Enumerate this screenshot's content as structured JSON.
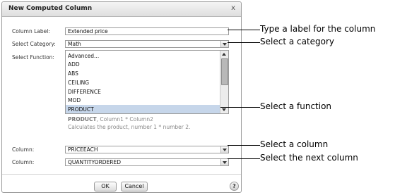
{
  "dialog": {
    "title": "New Computed Column",
    "close_glyph": "x",
    "column_label": {
      "label": "Column Label:",
      "value": "Extended price"
    },
    "category": {
      "label": "Select Category:",
      "value": "Math"
    },
    "function": {
      "label": "Select Function:",
      "items": [
        "Advanced...",
        "ADD",
        "ABS",
        "CEILING",
        "DIFFERENCE",
        "MOD",
        "PRODUCT"
      ],
      "selected": "PRODUCT"
    },
    "description": {
      "name": "PRODUCT",
      "signature": ", Column1 * Column2",
      "text": "Calculates the product, number 1 * number 2."
    },
    "column1": {
      "label": "Column:",
      "value": "PRICEEACH"
    },
    "column2": {
      "label": "Column:",
      "value": "QUANTITYORDERED"
    },
    "ok_label": "OK",
    "cancel_label": "Cancel",
    "help_glyph": "?"
  },
  "callouts": {
    "label": "Type a label for the column",
    "category": "Select a category",
    "function": "Select a function",
    "column": "Select a column",
    "next_column": "Select the next column"
  },
  "colors": {
    "selection": "#c6d6ea",
    "border": "#9c9c9c"
  }
}
